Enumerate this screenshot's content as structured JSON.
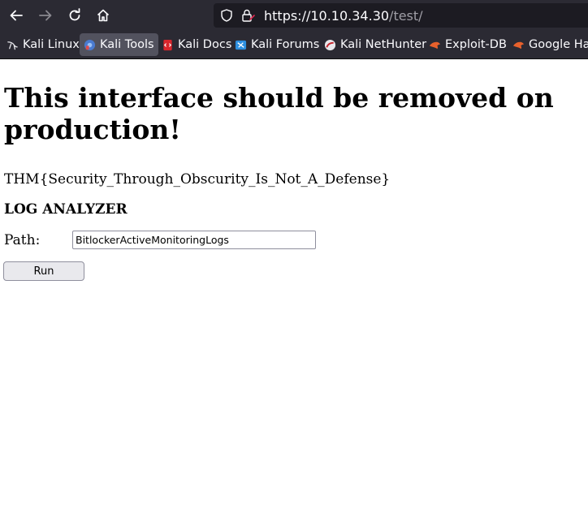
{
  "browser": {
    "url_host": "https://10.10.34.30",
    "url_path": "/test/",
    "bookmarks": [
      {
        "label": "Kali Linux",
        "icon": "kali-dragon-icon"
      },
      {
        "label": "Kali Tools",
        "icon": "kali-tools-icon"
      },
      {
        "label": "Kali Docs",
        "icon": "kali-docs-icon"
      },
      {
        "label": "Kali Forums",
        "icon": "kali-forums-icon"
      },
      {
        "label": "Kali NetHunter",
        "icon": "kali-nethunter-icon"
      },
      {
        "label": "Exploit-DB",
        "icon": "exploit-db-icon"
      },
      {
        "label": "Google Hac",
        "icon": "google-hacking-icon"
      }
    ],
    "colors": {
      "toolbar": "#2b2a33",
      "url_field": "#1c1b22",
      "active_bookmark": "#52525e"
    }
  },
  "page": {
    "heading": "This interface should be removed on production!",
    "flag": "THM{Security_Through_Obscurity_Is_Not_A_Defense}",
    "section_title": "LOG ANALYZER",
    "path_label": "Path:",
    "path_value": "BitlockerActiveMonitoringLogs",
    "run_label": "Run"
  }
}
